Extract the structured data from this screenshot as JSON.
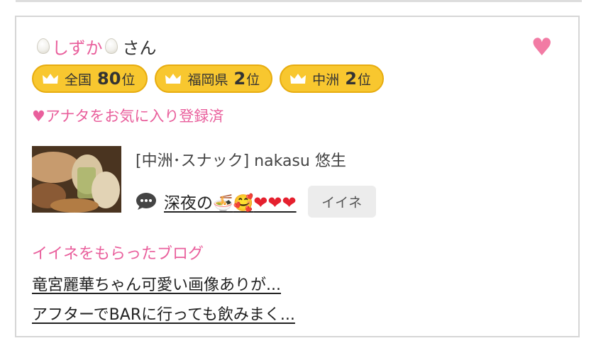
{
  "cast": {
    "name": "しずか",
    "honorific": "さん",
    "favorite_icon": "heart-icon"
  },
  "rankings": [
    {
      "area": "全国",
      "rank": "80",
      "suffix": "位"
    },
    {
      "area": "福岡県",
      "rank": "2",
      "suffix": "位"
    },
    {
      "area": "中洲",
      "rank": "2",
      "suffix": "位"
    }
  ],
  "favorite_status": "♥アナタをお気に入り登録済",
  "post": {
    "shop": "[中洲･スナック]  nakasu 悠生",
    "comment": "深夜の🍜🥰❤️❤️❤️",
    "comment_text": "深夜の",
    "like_button": "イイネ"
  },
  "blog_section": {
    "heading": "イイネをもらったブログ",
    "items": [
      "竜宮麗華ちゃん可愛い画像ありが...",
      "アフターでBARに行っても飲みまく..."
    ]
  },
  "colors": {
    "accent_pink": "#e95f9c",
    "rank_gold": "#f8c72f",
    "favorite_heart": "#f27ba4"
  }
}
